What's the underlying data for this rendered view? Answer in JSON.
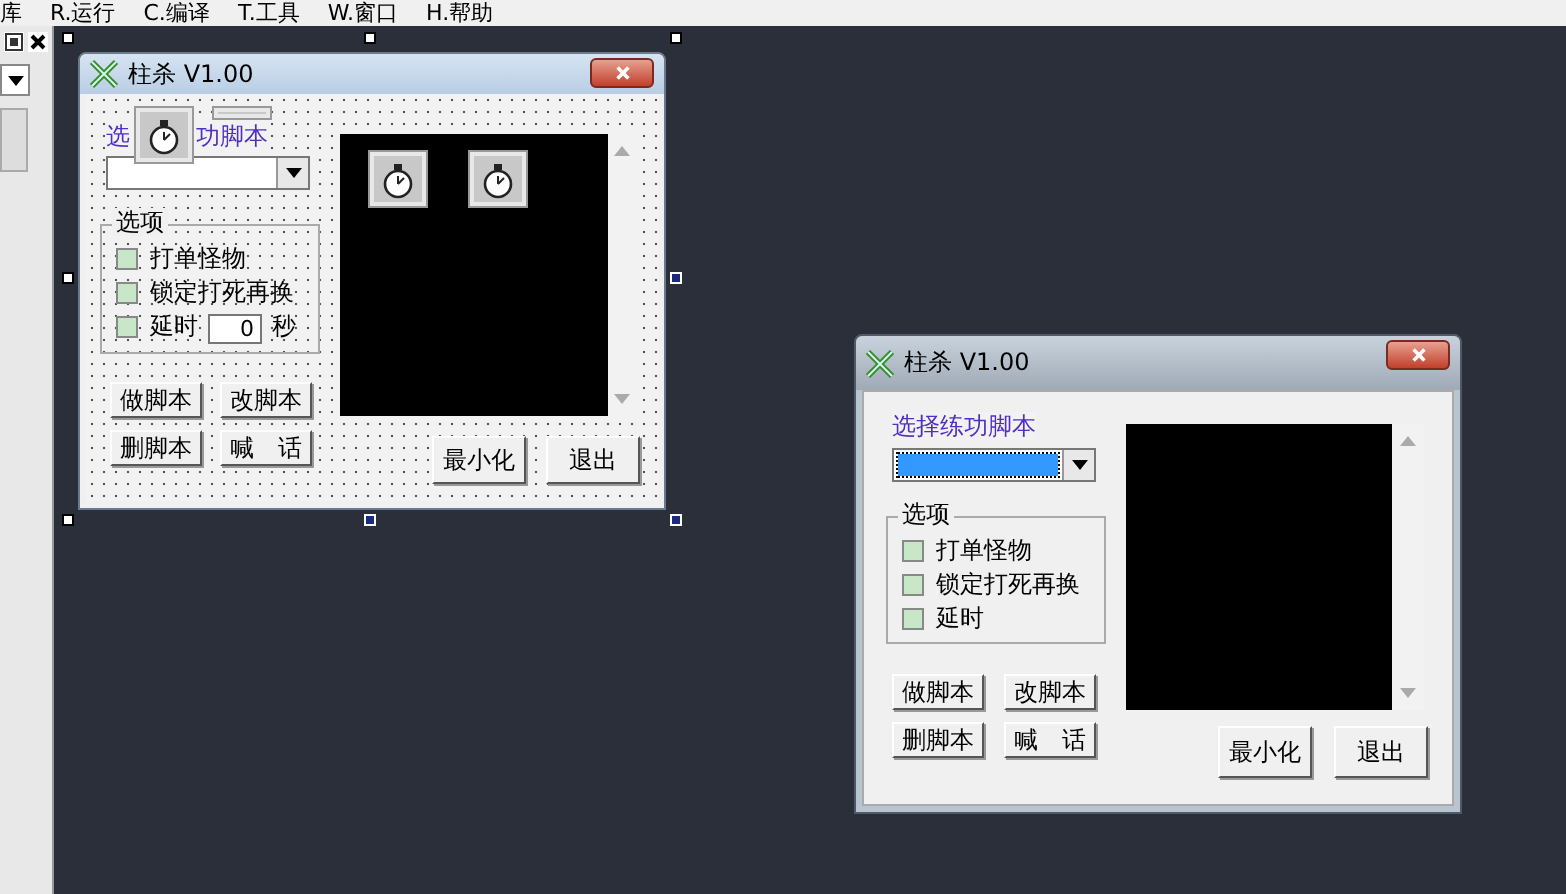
{
  "menu_bar": {
    "items": [
      {
        "label": "库"
      },
      {
        "label": "R.运行"
      },
      {
        "label": "C.编译"
      },
      {
        "label": "T.工具"
      },
      {
        "label": "W.窗口"
      },
      {
        "label": "H.帮助"
      }
    ]
  },
  "forms": [
    {
      "kind": "design",
      "title": "柱杀 V1.00",
      "label_parts": [
        "选",
        "功脚本"
      ],
      "combo": {
        "focused": false
      },
      "group_title": "选项",
      "checkboxes": [
        {
          "label": "打单怪物",
          "checked": false
        },
        {
          "label": "锁定打死再换",
          "checked": false
        },
        {
          "label": "延时",
          "checked": false
        }
      ],
      "delay": {
        "value": "0",
        "unit": "秒"
      },
      "buttons": [
        "做脚本",
        "改脚本",
        "删脚本",
        "喊　话"
      ],
      "bottom_buttons": [
        "最小化",
        "退出"
      ]
    },
    {
      "kind": "running",
      "title": "柱杀 V1.00",
      "label_parts": [
        "选择练功脚本"
      ],
      "combo": {
        "focused": true
      },
      "group_title": "选项",
      "checkboxes": [
        {
          "label": "打单怪物",
          "checked": false
        },
        {
          "label": "锁定打死再换",
          "checked": false
        },
        {
          "label": "延时",
          "checked": false
        }
      ],
      "buttons": [
        "做脚本",
        "改脚本",
        "删脚本",
        "喊　话"
      ],
      "bottom_buttons": [
        "最小化",
        "退出"
      ]
    }
  ]
}
